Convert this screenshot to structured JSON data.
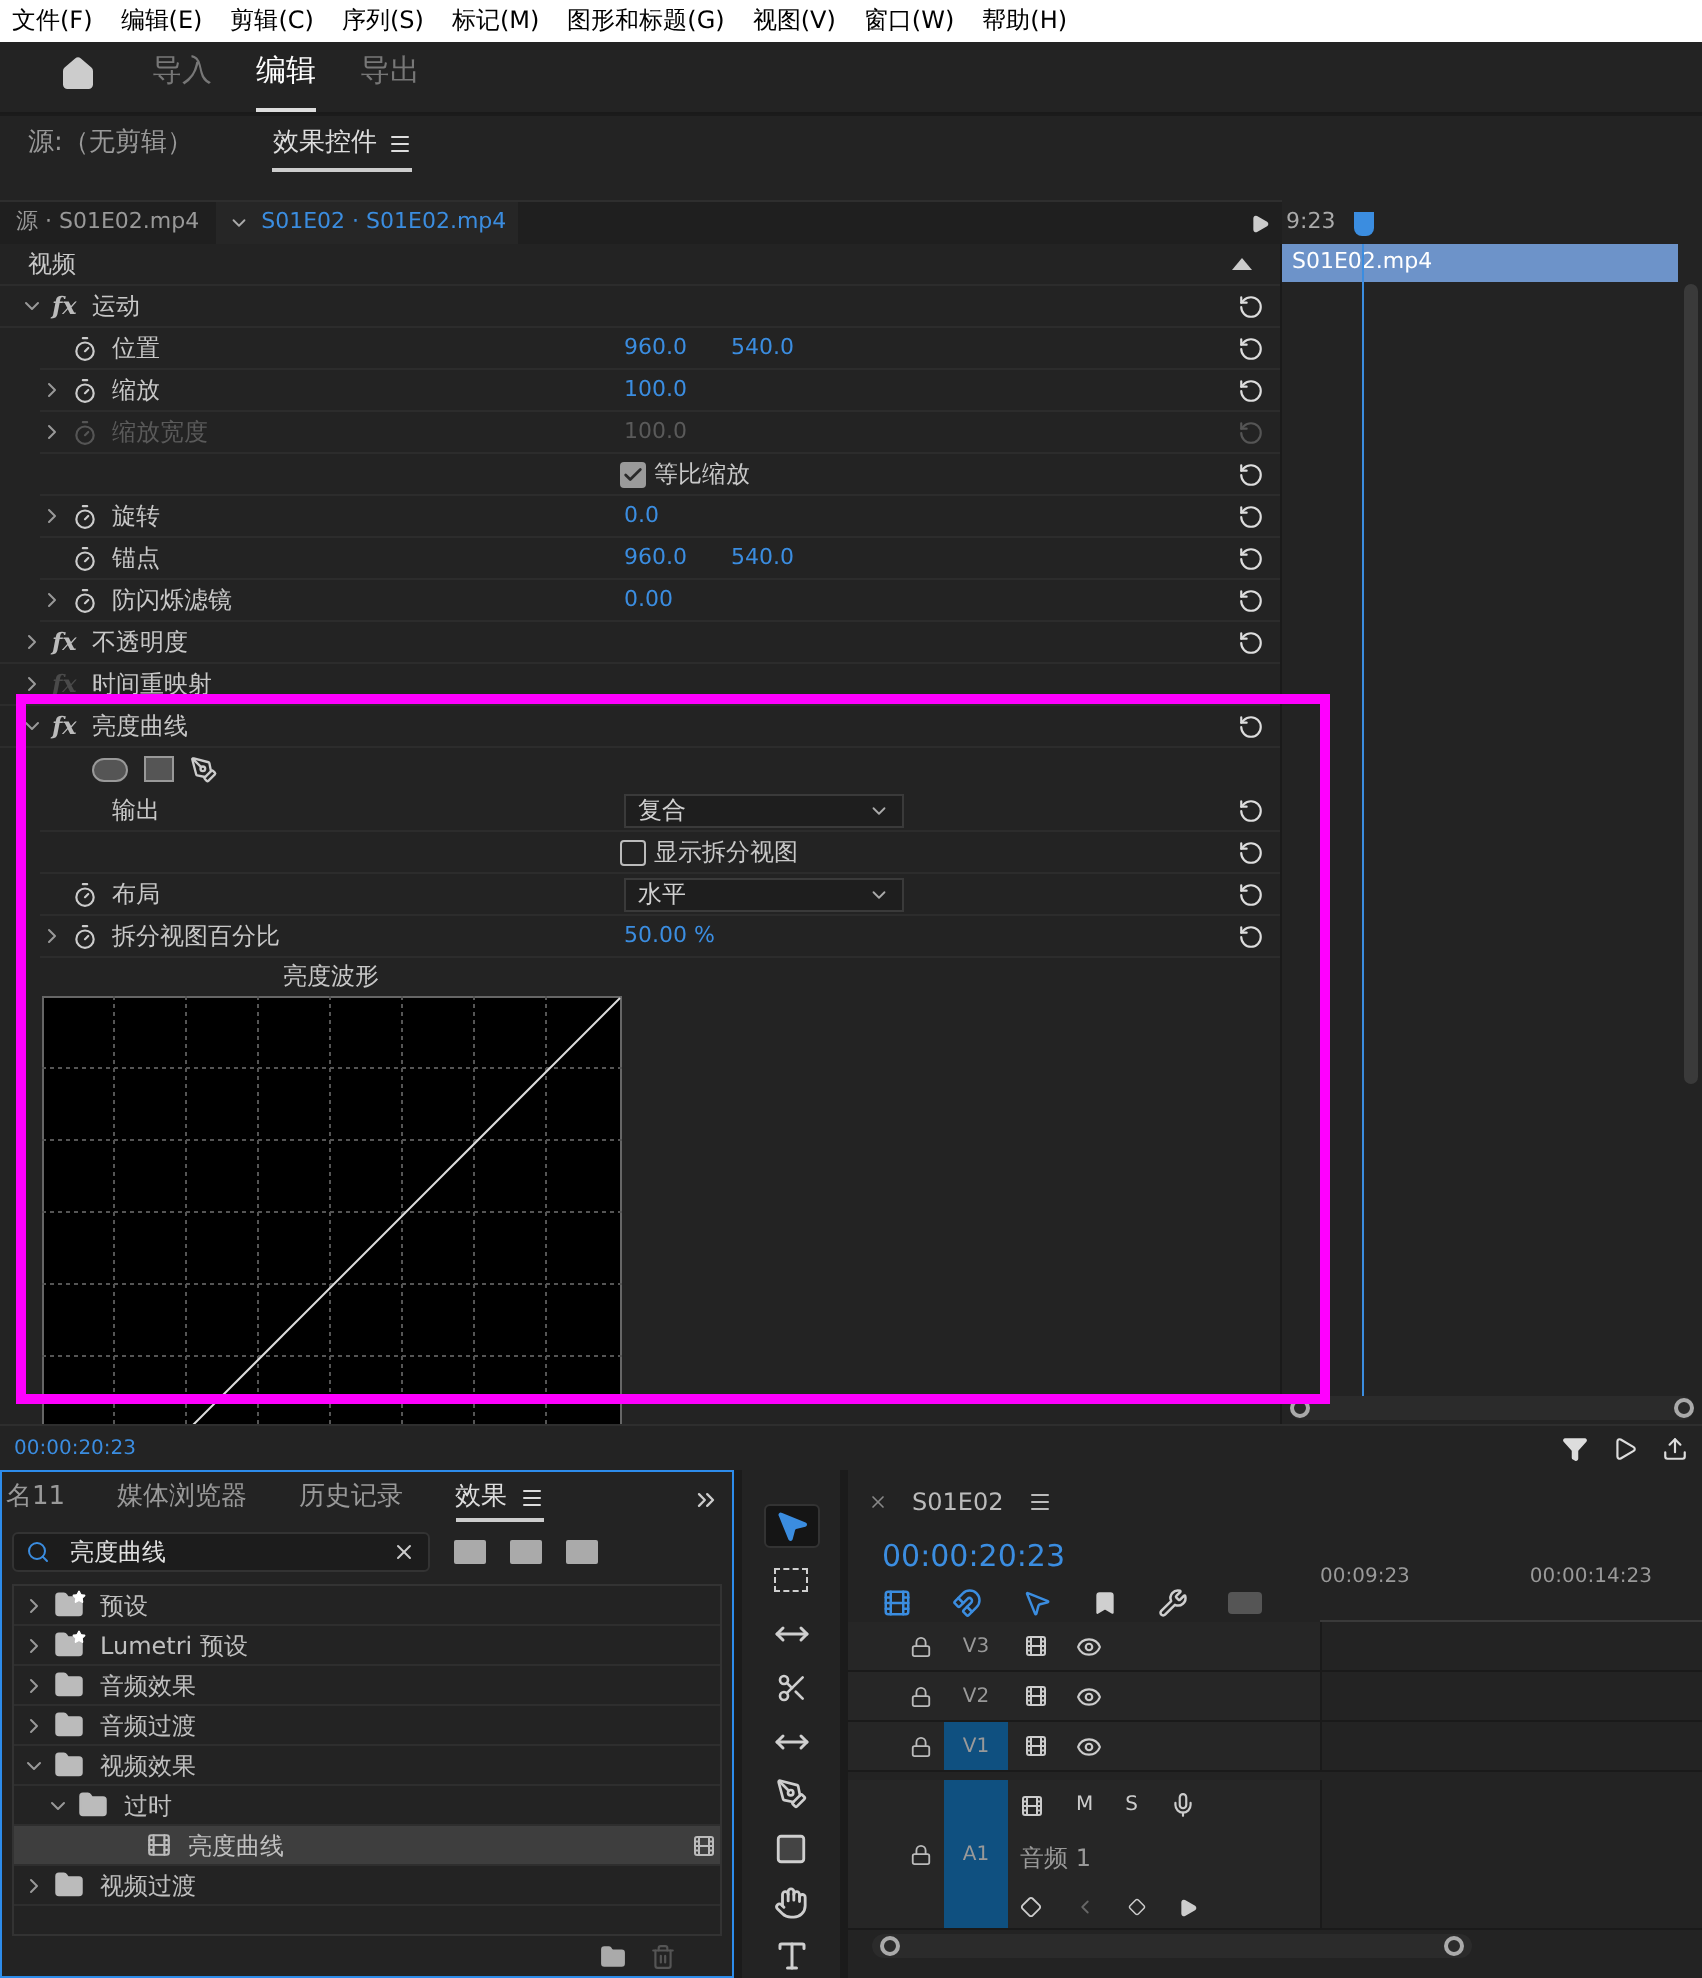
{
  "menu": [
    "文件(F)",
    "编辑(E)",
    "剪辑(C)",
    "序列(S)",
    "标记(M)",
    "图形和标题(G)",
    "视图(V)",
    "窗口(W)",
    "帮助(H)"
  ],
  "workspace_tabs": [
    {
      "label": "导入",
      "selected": false
    },
    {
      "label": "编辑",
      "selected": true
    },
    {
      "label": "导出",
      "selected": false
    }
  ],
  "panel_tabs": [
    {
      "label": "源:（无剪辑）",
      "selected": false
    },
    {
      "label": "效果控件",
      "selected": true
    }
  ],
  "effect_controls": {
    "source_tab": "源 · S01E02.mp4",
    "sequence_tab": "S01E02 · S01E02.mp4",
    "timecode": "9:23",
    "section": "视频",
    "clip": "S01E02.mp4",
    "current_time": "00:00:20:23",
    "effects": [
      {
        "name": "运动",
        "icon": "fx",
        "expanded": true,
        "fx_enabled": true,
        "reset": true,
        "properties": [
          {
            "kind": "value",
            "label": "位置",
            "twirl": false,
            "stopwatch": true,
            "disabled": false,
            "values": [
              "960.0",
              "540.0"
            ]
          },
          {
            "kind": "value",
            "label": "缩放",
            "twirl": true,
            "stopwatch": true,
            "disabled": false,
            "values": [
              "100.0"
            ]
          },
          {
            "kind": "value",
            "label": "缩放宽度",
            "twirl": true,
            "stopwatch": true,
            "disabled": true,
            "values": [
              "100.0"
            ]
          },
          {
            "kind": "checkbox",
            "label": "等比缩放",
            "checked": true
          },
          {
            "kind": "value",
            "label": "旋转",
            "twirl": true,
            "stopwatch": true,
            "disabled": false,
            "values": [
              "0.0"
            ]
          },
          {
            "kind": "value",
            "label": "锚点",
            "twirl": false,
            "stopwatch": true,
            "disabled": false,
            "values": [
              "960.0",
              "540.0"
            ]
          },
          {
            "kind": "value",
            "label": "防闪烁滤镜",
            "twirl": true,
            "stopwatch": true,
            "disabled": false,
            "values": [
              "0.00"
            ]
          }
        ]
      },
      {
        "name": "不透明度",
        "icon": "fx",
        "expanded": false,
        "fx_enabled": true,
        "reset": true
      },
      {
        "name": "时间重映射",
        "icon": "fx",
        "expanded": false,
        "fx_enabled": false,
        "reset": false
      },
      {
        "name": "亮度曲线",
        "icon": "fx",
        "expanded": true,
        "fx_enabled": true,
        "reset": true,
        "properties": [
          {
            "kind": "mask_tools"
          },
          {
            "kind": "dropdown",
            "label": "输出",
            "stopwatch": false,
            "value": "复合"
          },
          {
            "kind": "checkbox",
            "label": "显示拆分视图",
            "checked": false
          },
          {
            "kind": "dropdown",
            "label": "布局",
            "stopwatch": true,
            "value": "水平"
          },
          {
            "kind": "value",
            "label": "拆分视图百分比",
            "twirl": true,
            "stopwatch": true,
            "disabled": false,
            "values": [
              "50.00 %"
            ]
          },
          {
            "kind": "waveform",
            "label": "亮度波形"
          }
        ]
      }
    ]
  },
  "effects_panel": {
    "tabs": [
      {
        "label": "名11",
        "selected": false
      },
      {
        "label": "媒体浏览器",
        "selected": false
      },
      {
        "label": "历史记录",
        "selected": false
      },
      {
        "label": "效果",
        "selected": true
      }
    ],
    "search": "亮度曲线",
    "tree": [
      {
        "label": "预设",
        "kind": "preset",
        "expanded": false,
        "selected": false
      },
      {
        "label": "Lumetri 预设",
        "kind": "preset",
        "expanded": false,
        "selected": false
      },
      {
        "label": "音频效果",
        "kind": "folder",
        "expanded": false,
        "selected": false
      },
      {
        "label": "音频过渡",
        "kind": "folder",
        "expanded": false,
        "selected": false
      },
      {
        "label": "视频效果",
        "kind": "folder",
        "expanded": true,
        "selected": false,
        "children": [
          {
            "label": "过时",
            "kind": "folder",
            "expanded": true,
            "selected": false,
            "children": [
              {
                "label": "亮度曲线",
                "kind": "effect",
                "selected": true
              }
            ]
          }
        ]
      },
      {
        "label": "视频过渡",
        "kind": "folder",
        "expanded": false,
        "selected": false
      }
    ]
  },
  "tools": [
    {
      "kind": "select",
      "selected": true
    },
    {
      "kind": "track_select",
      "selected": false
    },
    {
      "kind": "ripple",
      "selected": false
    },
    {
      "kind": "razor",
      "selected": false
    },
    {
      "kind": "slip",
      "selected": false
    },
    {
      "kind": "pen",
      "selected": false
    },
    {
      "kind": "rectangle",
      "selected": false
    },
    {
      "kind": "hand",
      "selected": false
    },
    {
      "kind": "type",
      "selected": false
    }
  ],
  "timeline": {
    "sequence": "S01E02",
    "timecode": "00:00:20:23",
    "toolbar": [
      {
        "kind": "nest",
        "on": true
      },
      {
        "kind": "snap",
        "on": true
      },
      {
        "kind": "linked",
        "on": true
      },
      {
        "kind": "marker",
        "on": false
      },
      {
        "kind": "settings",
        "on": false
      },
      {
        "kind": "captions",
        "on": false
      }
    ],
    "ruler": [
      "00:09:23",
      "00:00:14:23"
    ],
    "tracks": [
      {
        "kind": "video",
        "label": "V3",
        "targeted": false
      },
      {
        "kind": "video",
        "label": "V2",
        "targeted": false
      },
      {
        "kind": "video",
        "label": "V1",
        "targeted": true
      },
      {
        "kind": "audio",
        "label": "A1",
        "targeted": true,
        "name": "音频 1",
        "mute": "M",
        "solo": "S"
      }
    ]
  }
}
